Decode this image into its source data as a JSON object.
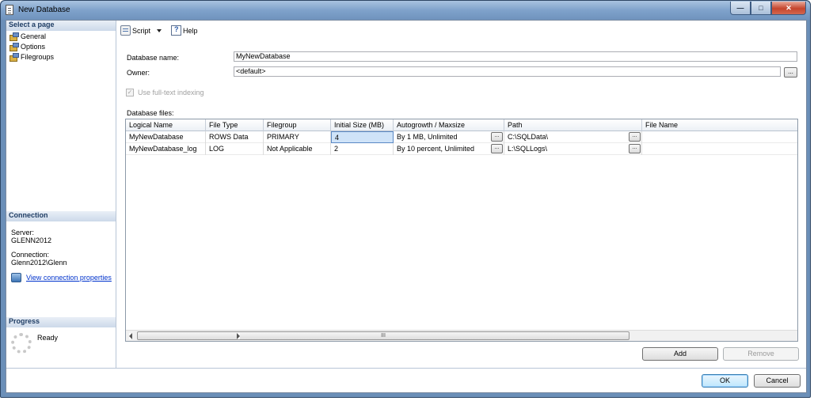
{
  "window": {
    "title": "New Database"
  },
  "left": {
    "select_page_header": "Select a page",
    "pages": [
      {
        "label": "General"
      },
      {
        "label": "Options"
      },
      {
        "label": "Filegroups"
      }
    ],
    "connection_header": "Connection",
    "server_label": "Server:",
    "server_value": "GLENN2012",
    "connection_label": "Connection:",
    "connection_value": "Glenn2012\\Glenn",
    "view_connection_link": "View connection properties",
    "progress_header": "Progress",
    "progress_status": "Ready"
  },
  "toolbar": {
    "script_label": "Script",
    "help_label": "Help"
  },
  "form": {
    "db_name_label": "Database name:",
    "db_name_value": "MyNewDatabase",
    "owner_label": "Owner:",
    "owner_value": "<default>",
    "fulltext_label": "Use full-text indexing",
    "fulltext_checked": true,
    "files_label": "Database files:"
  },
  "grid": {
    "columns": [
      "Logical Name",
      "File Type",
      "Filegroup",
      "Initial Size (MB)",
      "Autogrowth / Maxsize",
      "Path",
      "File Name"
    ],
    "rows": [
      {
        "logical_name": "MyNewDatabase",
        "file_type": "ROWS Data",
        "filegroup": "PRIMARY",
        "initial_size": "4",
        "autogrowth": "By 1 MB, Unlimited",
        "path": "C:\\SQLData\\",
        "file_name": ""
      },
      {
        "logical_name": "MyNewDatabase_log",
        "file_type": "LOG",
        "filegroup": "Not Applicable",
        "initial_size": "2",
        "autogrowth": "By 10 percent, Unlimited",
        "path": "L:\\SQLLogs\\",
        "file_name": ""
      }
    ],
    "ellipsis": "...",
    "scroll_grip": "III"
  },
  "buttons": {
    "add": "Add",
    "remove": "Remove",
    "ok": "OK",
    "cancel": "Cancel"
  },
  "colors": {
    "accent": "#0033cc",
    "selection": "#cfe3f8"
  }
}
